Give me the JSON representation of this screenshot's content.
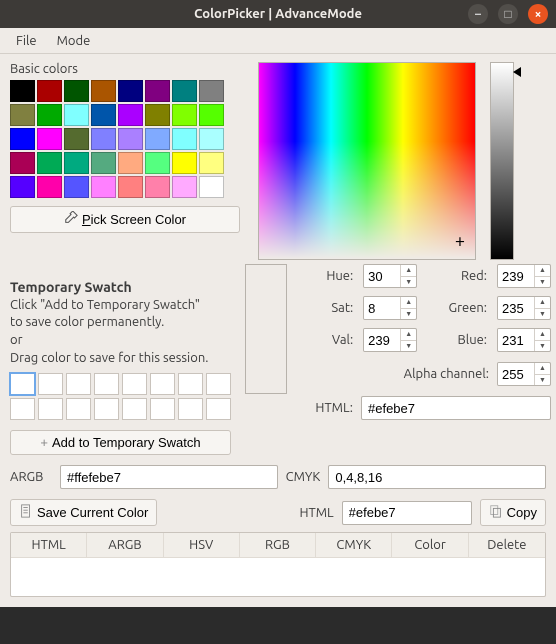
{
  "window": {
    "title": "ColorPicker | AdvanceMode",
    "minimize": "–",
    "maximize": "□",
    "close": "×"
  },
  "menu": {
    "file": "File",
    "mode": "Mode"
  },
  "basic_colors": {
    "label": "Basic colors",
    "grid": [
      [
        "#000000",
        "#aa0000",
        "#005500",
        "#aa5500",
        "#000080",
        "#800080",
        "#008080",
        "#808080"
      ],
      [
        "#808040",
        "#00aa00",
        "#80ffff",
        "#0055aa",
        "#aa00ff",
        "#808000",
        "#80ff00",
        "#55ff00"
      ],
      [
        "#0000ff",
        "#ff00ff",
        "#556b2f",
        "#8080ff",
        "#aa80ff",
        "#80aaff",
        "#80ffff",
        "#aaffff"
      ],
      [
        "#aa0055",
        "#00aa55",
        "#00aa80",
        "#55aa80",
        "#ffaa80",
        "#55ff80",
        "#ffff00",
        "#ffff80"
      ],
      [
        "#5500ff",
        "#ff00aa",
        "#5555ff",
        "#ff80ff",
        "#ff8080",
        "#ff80aa",
        "#ffaaff",
        "#ffffff"
      ]
    ]
  },
  "pick_btn": "Pick Screen Color",
  "temp_swatch": {
    "title": "Temporary Swatch",
    "desc1": "Click \"Add to Temporary Swatch\"",
    "desc2": "to save color permanently.",
    "desc3": "or",
    "desc4": "Drag color to save for this session.",
    "add_btn": "Add to Temporary Swatch"
  },
  "channels": {
    "hue_label": "Hue:",
    "hue": "30",
    "sat_label": "Sat:",
    "sat": "8",
    "val_label": "Val:",
    "val": "239",
    "red_label": "Red:",
    "red": "239",
    "green_label": "Green:",
    "green": "235",
    "blue_label": "Blue:",
    "blue": "231",
    "alpha_label": "Alpha channel:",
    "alpha": "255"
  },
  "html_top": {
    "label": "HTML:",
    "value": "#efebe7"
  },
  "argb": {
    "label": "ARGB",
    "value": "#ffefebe7"
  },
  "cmyk": {
    "label": "CMYK",
    "value": "0,4,8,16"
  },
  "save_btn": "Save Current Color",
  "html_bottom": {
    "label": "HTML",
    "value": "#efebe7"
  },
  "copy_btn": "Copy",
  "table": {
    "headers": [
      "HTML",
      "ARGB",
      "HSV",
      "RGB",
      "CMYK",
      "Color",
      "Delete"
    ]
  },
  "preview_color": "#efebe7"
}
